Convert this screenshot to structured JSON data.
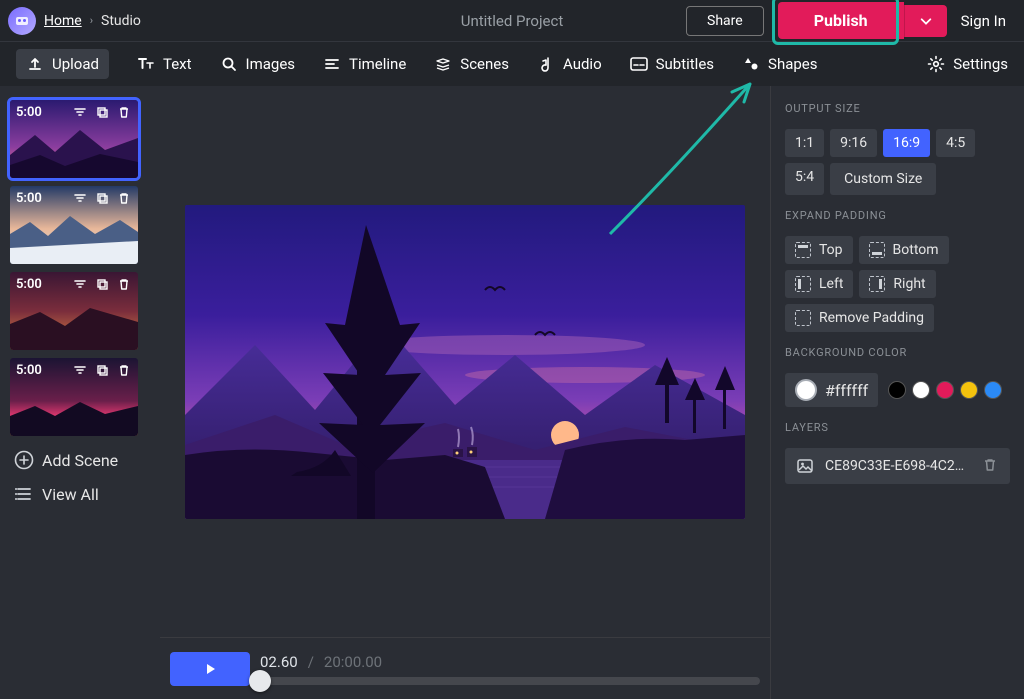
{
  "header": {
    "home": "Home",
    "breadcrumb": "Studio",
    "title": "Untitled Project",
    "share": "Share",
    "publish": "Publish",
    "signin": "Sign In"
  },
  "toolbar": {
    "upload": "Upload",
    "text": "Text",
    "images": "Images",
    "timeline": "Timeline",
    "scenes": "Scenes",
    "audio": "Audio",
    "subtitles": "Subtitles",
    "shapes": "Shapes",
    "settings": "Settings"
  },
  "scenes": {
    "items": [
      {
        "duration": "5:00"
      },
      {
        "duration": "5:00"
      },
      {
        "duration": "5:00"
      },
      {
        "duration": "5:00"
      }
    ],
    "add": "Add Scene",
    "viewall": "View All"
  },
  "timeline": {
    "current": "02.60",
    "separator": "/",
    "total": "20:00.00"
  },
  "panel": {
    "output_size_label": "OUTPUT SIZE",
    "ratios": [
      "1:1",
      "9:16",
      "16:9",
      "4:5",
      "5:4"
    ],
    "ratio_selected": "16:9",
    "custom_size": "Custom Size",
    "expand_label": "EXPAND PADDING",
    "pad_top": "Top",
    "pad_bottom": "Bottom",
    "pad_left": "Left",
    "pad_right": "Right",
    "pad_remove": "Remove Padding",
    "bg_label": "BACKGROUND COLOR",
    "bg_value": "#ffffff",
    "swatches": [
      "#000000",
      "#ffffff",
      "#e21b5a",
      "#f4c20d",
      "#2b8af6"
    ],
    "layers_label": "LAYERS",
    "layer_name": "CE89C33E-E698-4C2D-..."
  }
}
